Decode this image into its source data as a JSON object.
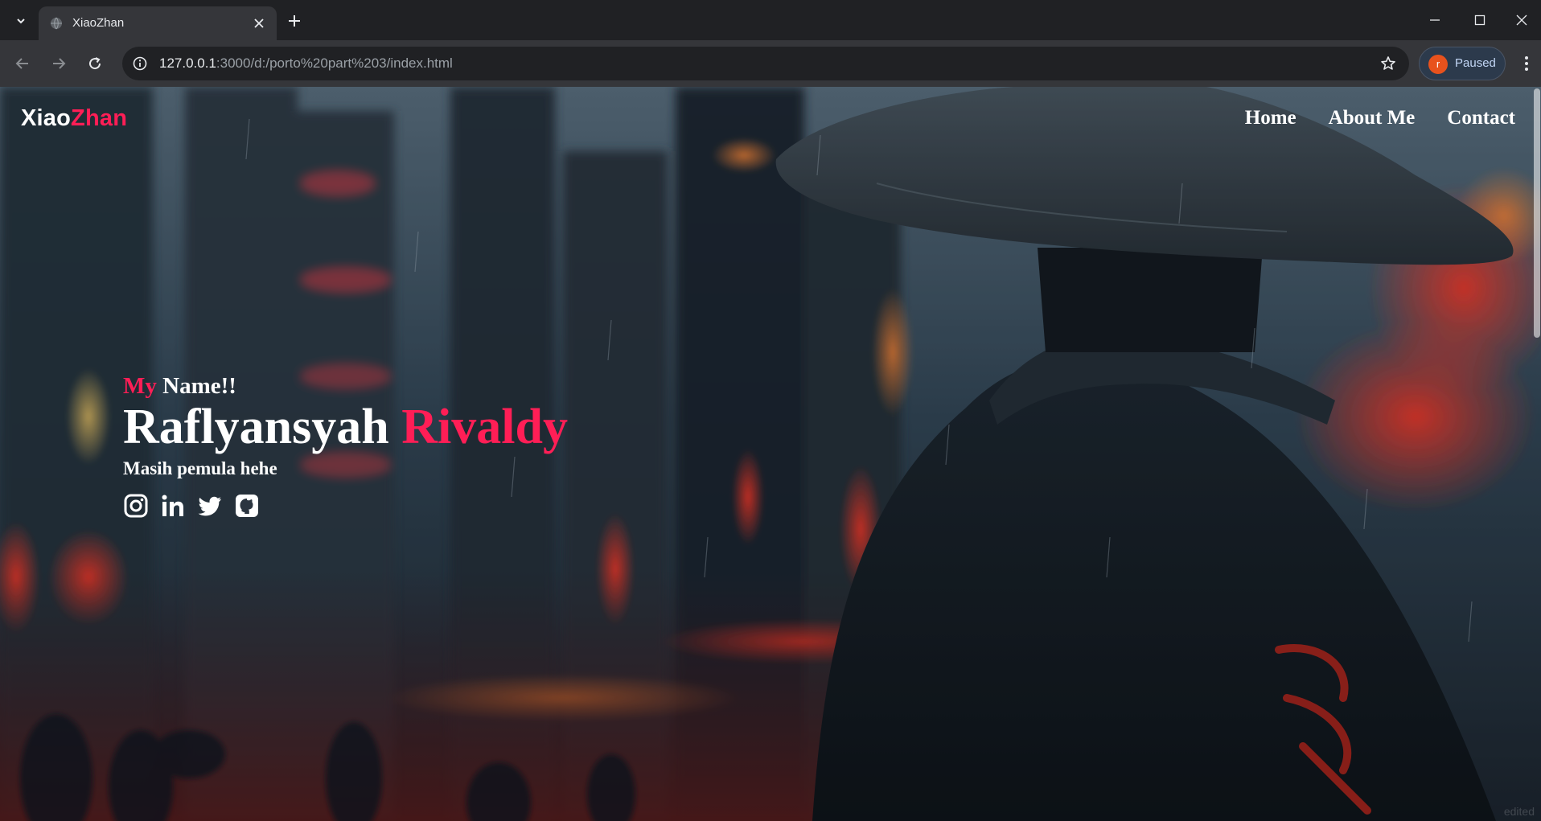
{
  "browser": {
    "tab": {
      "title": "XiaoZhan"
    },
    "url": {
      "host": "127.0.0.1",
      "path": ":3000/d:/porto%20part%203/index.html"
    },
    "profile": {
      "initial": "r",
      "label": "Paused"
    },
    "icons": [
      "tab-search-icon",
      "globe-icon",
      "close-icon",
      "plus-icon",
      "minimize-icon",
      "maximize-icon",
      "window-close-icon",
      "back-arrow-icon",
      "forward-arrow-icon",
      "reload-icon",
      "site-info-icon",
      "bookmark-star-icon",
      "kebab-menu-icon"
    ]
  },
  "page": {
    "logo": {
      "main": "Xiao",
      "accent": "Zhan"
    },
    "nav": [
      {
        "label": "Home"
      },
      {
        "label": "About Me"
      },
      {
        "label": "Contact"
      }
    ],
    "hero": {
      "greeting_accent": "My",
      "greeting_rest": " Name!!",
      "first_name": "Raflyansyah",
      "last_name": "Rivaldy",
      "tagline": "Masih pemula hehe"
    },
    "socials": [
      "instagram-icon",
      "linkedin-icon",
      "twitter-icon",
      "github-icon"
    ],
    "watermark": "edited"
  },
  "colors": {
    "accent": "#ff1e56",
    "tab_active": "#35363a",
    "tab_strip": "#202124",
    "omnibox": "#202124",
    "text": "#ffffff"
  }
}
